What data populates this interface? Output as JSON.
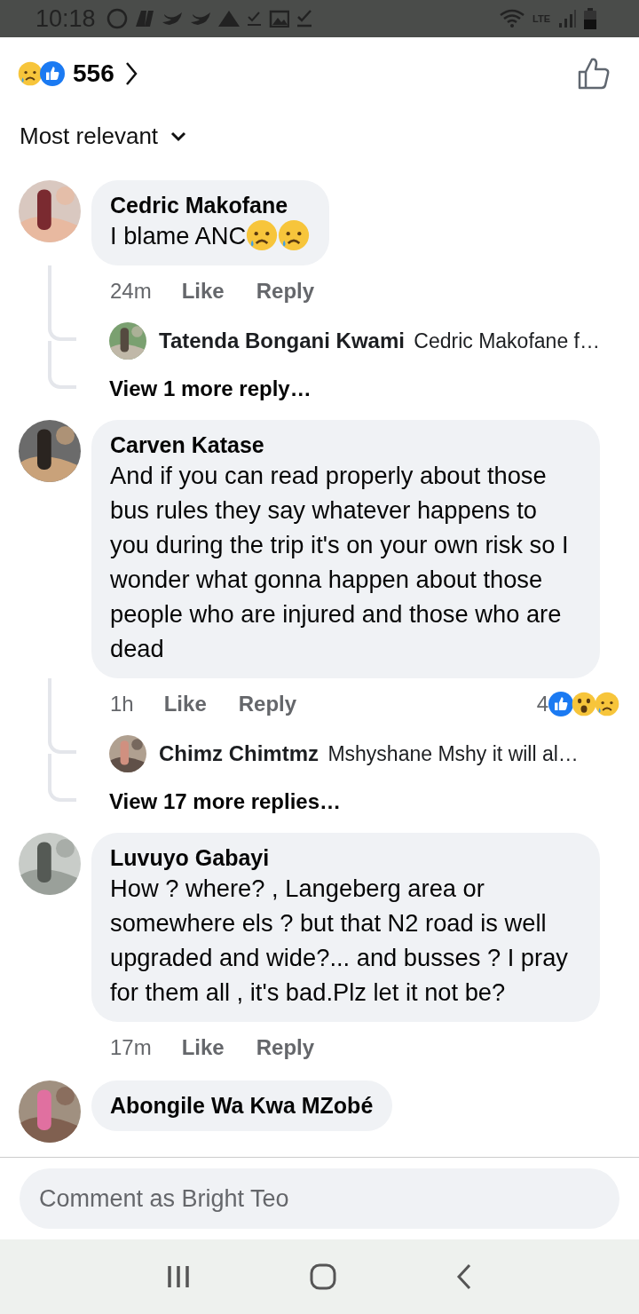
{
  "status_bar": {
    "time": "10:18",
    "network": "LTE"
  },
  "reactions": {
    "icons": [
      {
        "kind": "sad"
      },
      {
        "kind": "like"
      }
    ],
    "count": "556"
  },
  "sort": {
    "label": "Most relevant"
  },
  "comments": [
    {
      "author": "Cedric Makofane",
      "text": "I blame ANC",
      "emoji": [
        {
          "kind": "sad"
        },
        {
          "kind": "sad"
        }
      ],
      "time": "24m",
      "like": "Like",
      "reply": "Reply",
      "replies": [
        {
          "author": "Tatenda Bongani Kwami",
          "text": "Cedric Makofane f…"
        }
      ],
      "view_more": "View 1 more reply…"
    },
    {
      "author": "Carven Katase",
      "text": "And if you can read properly about those bus rules they say whatever happens to you during the trip it's on your own risk so I wonder what gonna happen about those people who are injured and those who are dead",
      "time": "1h",
      "like": "Like",
      "reply": "Reply",
      "reactions": {
        "count": "4",
        "icons": [
          {
            "kind": "like"
          },
          {
            "kind": "wow"
          },
          {
            "kind": "sad"
          }
        ]
      },
      "replies": [
        {
          "author": "Chimz Chimtmz",
          "text": "Mshyshane Mshy it will al…"
        }
      ],
      "view_more": "View 17 more replies…"
    },
    {
      "author": "Luvuyo Gabayi",
      "text": "How ? where? , Langeberg area or somewhere els  ? but that N2 road is well upgraded and wide?... and busses ? I pray for them all , it's bad.Plz let it not be?",
      "time": "17m",
      "like": "Like",
      "reply": "Reply"
    },
    {
      "author": "Abongile Wa Kwa MZobé"
    }
  ],
  "composer": {
    "placeholder": "Comment as Bright Teo"
  }
}
